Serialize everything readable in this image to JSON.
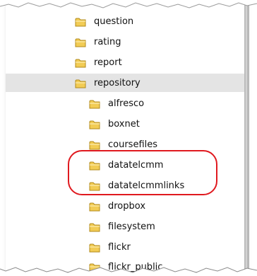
{
  "tree": {
    "items": [
      {
        "label": "question"
      },
      {
        "label": "rating"
      },
      {
        "label": "report"
      },
      {
        "label": "repository"
      },
      {
        "label": "alfresco"
      },
      {
        "label": "boxnet"
      },
      {
        "label": "coursefiles"
      },
      {
        "label": "datatelcmm"
      },
      {
        "label": "datatelcmmlinks"
      },
      {
        "label": "dropbox"
      },
      {
        "label": "filesystem"
      },
      {
        "label": "flickr"
      },
      {
        "label": "flickr_public"
      }
    ]
  },
  "colors": {
    "selected_row": "#e4e4e4",
    "folder_fill": "#f2cc55",
    "folder_edge": "#b18a1a",
    "highlight_oval": "#e0191f"
  }
}
